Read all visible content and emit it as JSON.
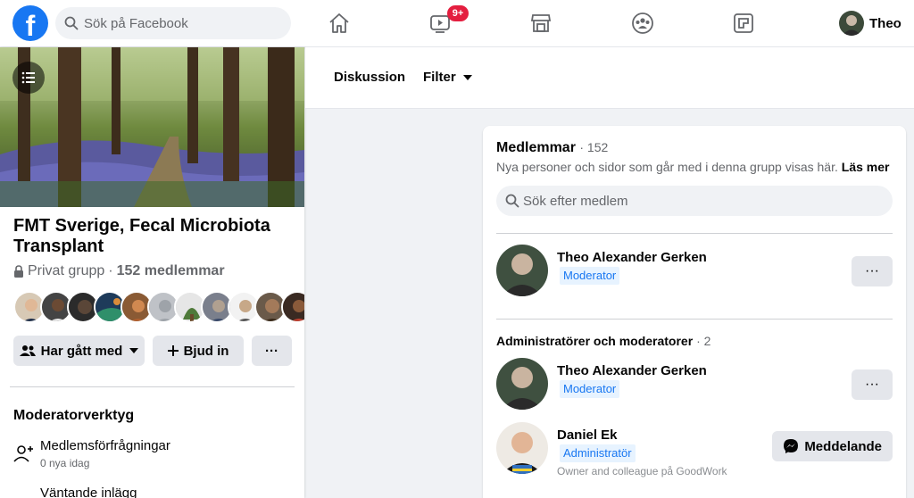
{
  "topbar": {
    "logo_letter": "f",
    "search_placeholder": "Sök på Facebook",
    "watch_badge": "9+",
    "profile_name": "Theo"
  },
  "group": {
    "title": "FMT Sverige, Fecal Microbiota Transplant",
    "privacy": "Privat grupp",
    "separator": "·",
    "member_count": "152 medlemmar",
    "joined_label": "Har gått med",
    "invite_label": "Bjud in",
    "more_label": "···"
  },
  "tools": {
    "title": "Moderatorverktyg",
    "items": [
      {
        "label": "Medlemsförfrågningar",
        "sub": "0 nya idag"
      },
      {
        "label": "Väntande inlägg",
        "sub": ""
      }
    ]
  },
  "tabs": {
    "discussion": "Diskussion",
    "filter": "Filter"
  },
  "members": {
    "title": "Medlemmar",
    "count": "· 152",
    "description": "Nya personer och sidor som går med i denna grupp visas här.",
    "read_more": "Läs mer",
    "search_placeholder": "Sök efter medlem",
    "you": {
      "name": "Theo Alexander Gerken",
      "role": "Moderator"
    },
    "admins_title": "Administratörer och moderatorer",
    "admins_count": "· 2",
    "admins": [
      {
        "name": "Theo Alexander Gerken",
        "role": "Moderator",
        "note": ""
      },
      {
        "name": "Daniel Ek",
        "role": "Administratör",
        "note": "Owner and colleague på GoodWork",
        "action": "Meddelande"
      }
    ],
    "more_label": "···"
  },
  "colors": {
    "brand": "#1877f2",
    "badge": "#e41e3f",
    "role_bg": "#e7f3ff"
  }
}
